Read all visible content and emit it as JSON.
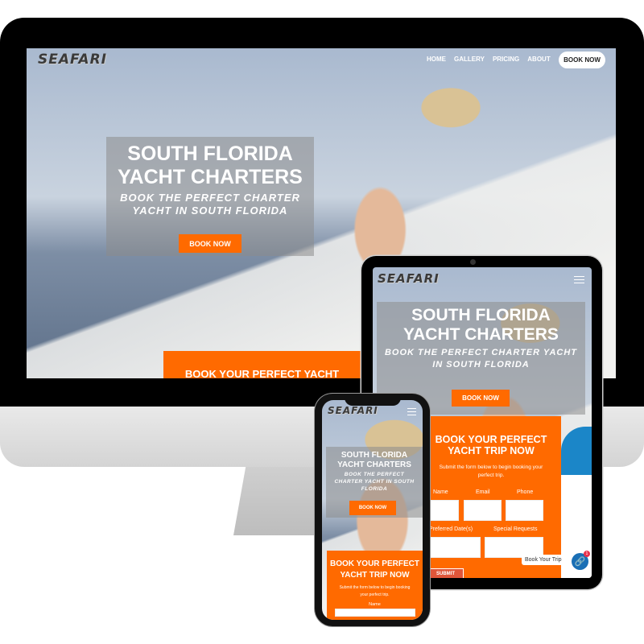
{
  "brand": {
    "logo": "SEAFARI",
    "accent": "#ff6a00",
    "link_blue": "#1a6fb5"
  },
  "desktop": {
    "nav": [
      {
        "label": "HOME"
      },
      {
        "label": "GALLERY"
      },
      {
        "label": "PRICING"
      },
      {
        "label": "ABOUT"
      }
    ],
    "nav_cta": "BOOK NOW",
    "hero": {
      "title_line1": "SOUTH FLORIDA",
      "title_line2": "YACHT CHARTERS",
      "subtitle_line1": "BOOK THE PERFECT CHARTER",
      "subtitle_line2": "YACHT IN SOUTH FLORIDA",
      "button": "BOOK NOW"
    },
    "form_title": "BOOK YOUR PERFECT YACHT"
  },
  "tablet": {
    "hero": {
      "title_line1": "SOUTH FLORIDA",
      "title_line2": "YACHT CHARTERS",
      "subtitle_line1": "BOOK THE PERFECT CHARTER YACHT",
      "subtitle_line2": "IN SOUTH FLORIDA",
      "button": "BOOK NOW"
    },
    "form": {
      "title_line1": "BOOK YOUR PERFECT",
      "title_line2": "YACHT TRIP NOW",
      "intro_line1": "Submit the form below to begin booking your",
      "intro_line2": "perfect trip.",
      "fields": {
        "name": "Name",
        "email": "Email",
        "phone": "Phone",
        "dates": "Preferred Date(s)",
        "requests": "Special Requests"
      },
      "submit": "SUBMIT"
    },
    "chat": {
      "label": "Book Your Trip",
      "badge": "1",
      "icon": "link-icon"
    }
  },
  "phone": {
    "hero": {
      "title_line1": "SOUTH FLORIDA",
      "title_line2": "YACHT CHARTERS",
      "subtitle_line1": "BOOK THE PERFECT",
      "subtitle_line2": "CHARTER YACHT IN SOUTH",
      "subtitle_line3": "FLORIDA",
      "button": "BOOK NOW"
    },
    "form": {
      "title_line1": "BOOK YOUR PERFECT",
      "title_line2": "YACHT TRIP NOW",
      "intro_line1": "Submit the form below to begin booking",
      "intro_line2": "your perfect trip.",
      "name_label": "Name"
    }
  }
}
